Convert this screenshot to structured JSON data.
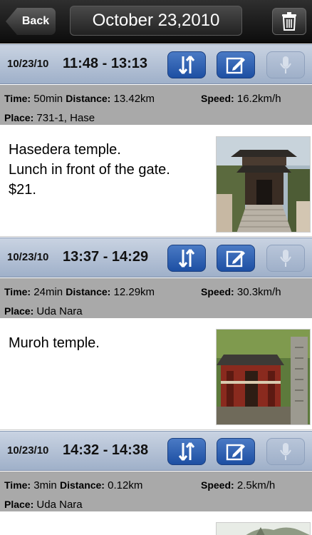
{
  "navbar": {
    "back_label": "Back",
    "title": "October 23,2010",
    "trash_icon": "trash-icon"
  },
  "entries": [
    {
      "date": "10/23/10",
      "time_range": "11:48 - 13:13",
      "time_label": "Time:",
      "time_value": "50min",
      "distance_label": "Distance:",
      "distance_value": "13.42km",
      "speed_label": "Speed:",
      "speed_value": "16.2km/h",
      "place_label": "Place:",
      "place_value": "731-1, Hase",
      "note": "Hasedera temple.\nLunch in front of the gate.\n$21."
    },
    {
      "date": "10/23/10",
      "time_range": "13:37 - 14:29",
      "time_label": "Time:",
      "time_value": "24min",
      "distance_label": "Distance:",
      "distance_value": "12.29km",
      "speed_label": "Speed:",
      "speed_value": "30.3km/h",
      "place_label": "Place:",
      "place_value": "Uda Nara",
      "note": "Muroh temple."
    },
    {
      "date": "10/23/10",
      "time_range": "14:32 - 14:38",
      "time_label": "Time:",
      "time_value": "3min",
      "distance_label": "Distance:",
      "distance_value": "0.12km",
      "speed_label": "Speed:",
      "speed_value": "2.5km/h",
      "place_label": "Place:",
      "place_value": "Uda Nara",
      "note": ""
    }
  ],
  "colors": {
    "header_blue": "#9fb0c9",
    "button_blue": "#1d4fa3",
    "info_gray": "#a9a9a9"
  }
}
